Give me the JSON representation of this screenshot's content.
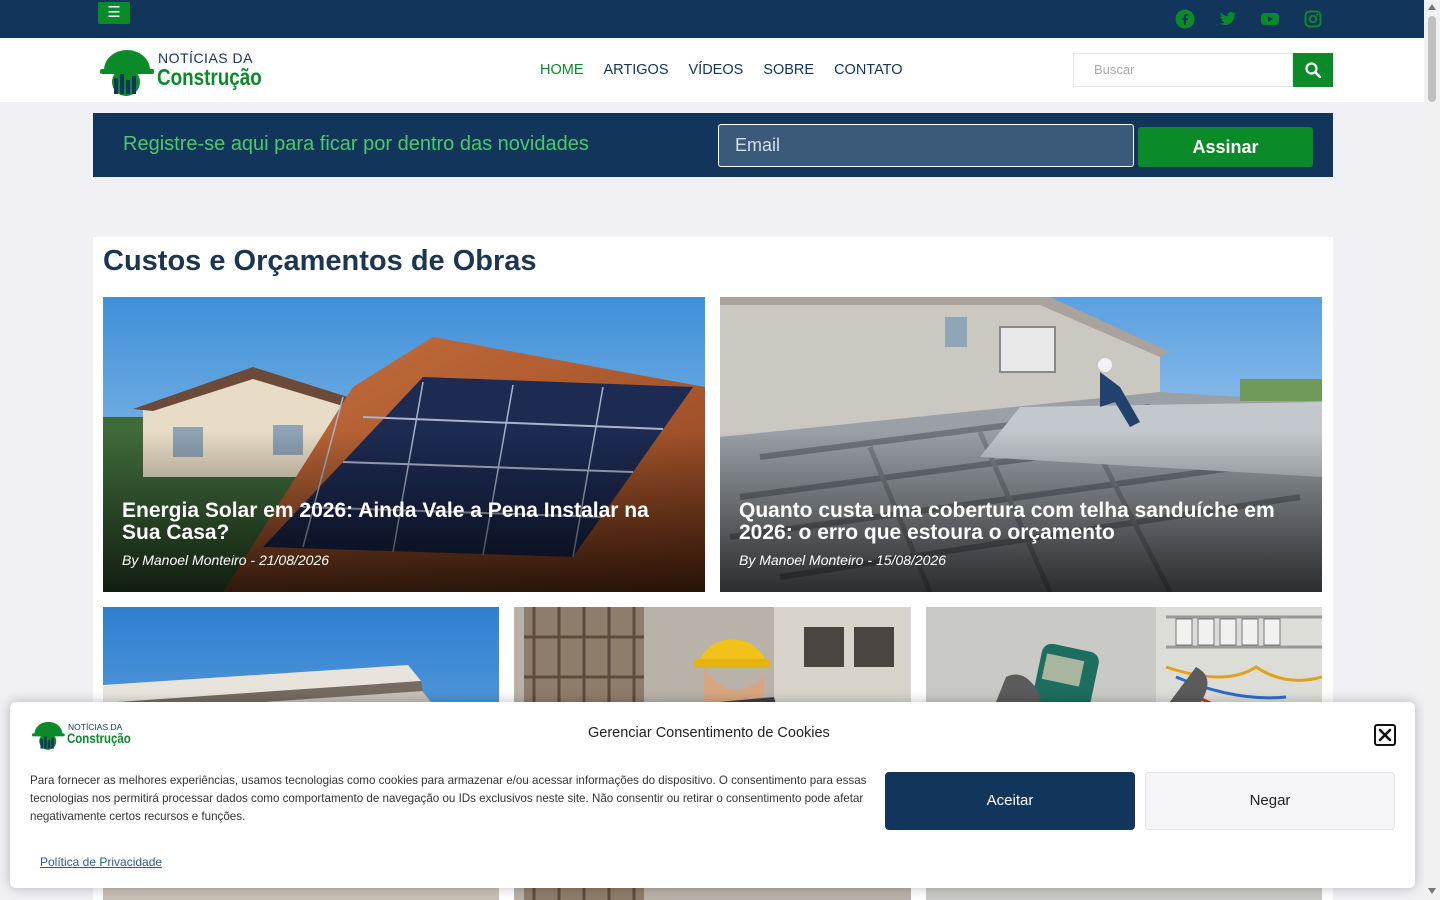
{
  "topbar": {
    "menu_icon": "☰",
    "social": [
      "facebook-icon",
      "twitter-icon",
      "youtube-icon",
      "instagram-icon"
    ]
  },
  "header": {
    "logo_top": "NOTÍCIAS DA",
    "logo_bottom": "Construção",
    "nav": [
      {
        "label": "HOME",
        "active": true
      },
      {
        "label": "ARTIGOS"
      },
      {
        "label": "VÍDEOS"
      },
      {
        "label": "SOBRE"
      },
      {
        "label": "CONTATO"
      }
    ],
    "search_placeholder": "Buscar"
  },
  "newsletter": {
    "text": "Registre-se aqui para ficar por dentro das novidades",
    "email_placeholder": "Email",
    "button": "Assinar"
  },
  "section": {
    "title": "Custos e Orçamentos de Obras",
    "featured": [
      {
        "title": "Energia Solar em 2026: Ainda Vale a Pena Instalar na Sua Casa?",
        "meta": "By Manoel Monteiro  -  21/08/2026"
      },
      {
        "title": "Quanto custa uma cobertura com telha sanduíche em 2026: o erro que estoura o orçamento",
        "meta": "By Manoel Monteiro  -  15/08/2026"
      }
    ]
  },
  "cookie": {
    "title": "Gerenciar Consentimento de Cookies",
    "text": "Para fornecer as melhores experiências, usamos tecnologias como cookies para armazenar e/ou acessar informações do dispositivo. O consentimento para essas tecnologias nos permitirá processar dados como comportamento de navegação ou IDs exclusivos neste site. Não consentir ou retirar o consentimento pode afetar negativamente certos recursos e funções.",
    "accept": "Aceitar",
    "deny": "Negar",
    "privacy_link": "Política de Privacidade",
    "logo_top": "NOTÍCIAS DA",
    "logo_bottom": "Construção"
  },
  "colors": {
    "brand_dark": "#12355b",
    "brand_green": "#0b8a2a",
    "accent_green": "#4cc96a"
  }
}
